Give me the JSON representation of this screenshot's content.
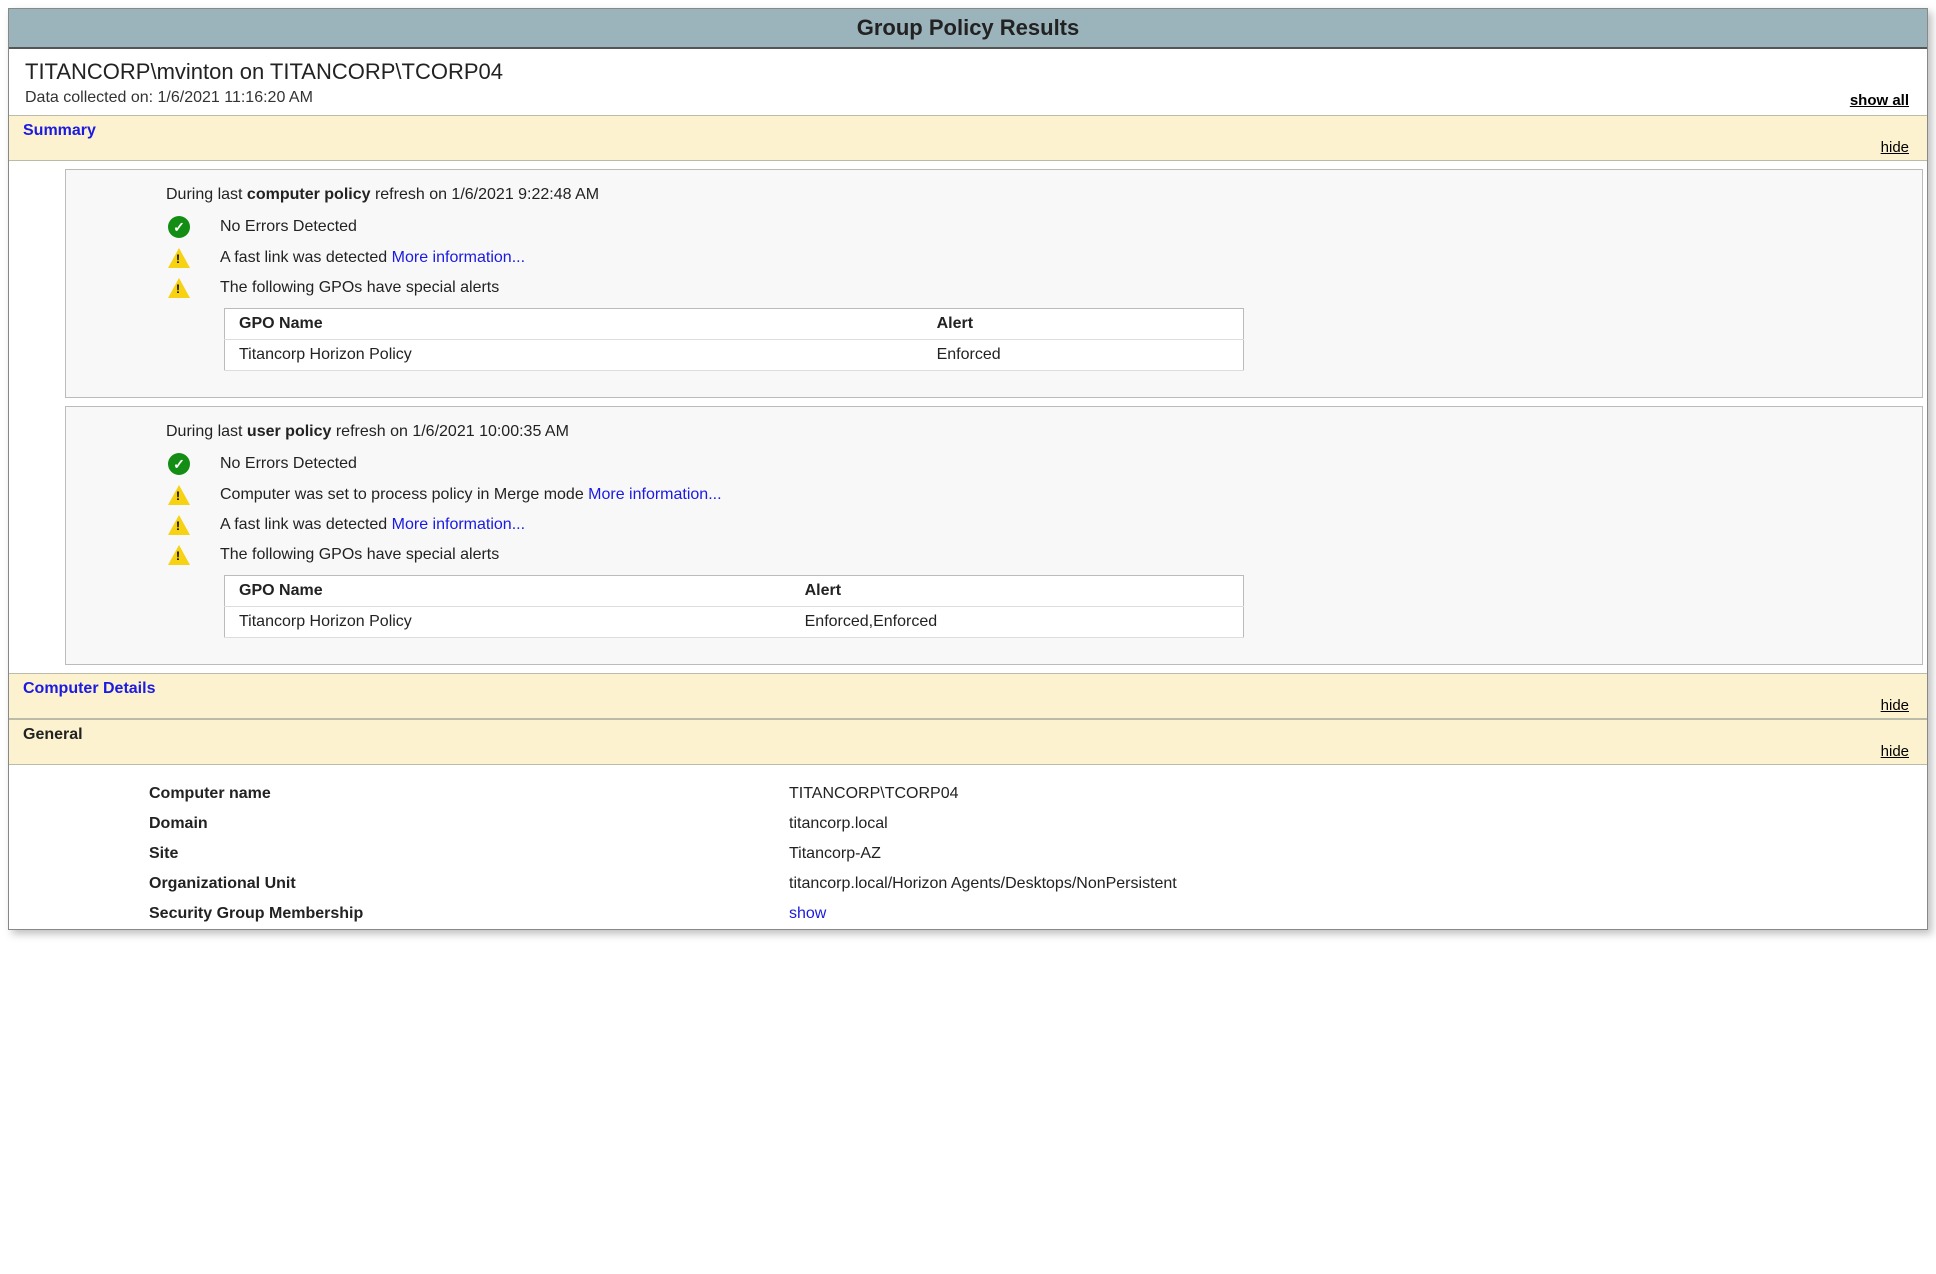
{
  "title": "Group Policy Results",
  "header": {
    "main": "TITANCORP\\mvinton on TITANCORP\\TCORP04",
    "collected_label": "Data collected on: 1/6/2021 11:16:20 AM",
    "show_all": "show all"
  },
  "sections": {
    "summary": {
      "label": "Summary",
      "toggle": "hide"
    },
    "computer_details": {
      "label": "Computer Details",
      "toggle": "hide"
    },
    "general": {
      "label": "General",
      "toggle": "hide"
    }
  },
  "summary": {
    "computer": {
      "heading_prefix": "During last ",
      "heading_bold": "computer policy",
      "heading_suffix": " refresh on 1/6/2021 9:22:48 AM",
      "rows": [
        {
          "icon": "check",
          "text": "No Errors Detected",
          "link": ""
        },
        {
          "icon": "warn",
          "text": "A fast link was detected ",
          "link": "More information..."
        },
        {
          "icon": "warn",
          "text": "The following GPOs have special alerts",
          "link": ""
        }
      ],
      "table": {
        "headers": [
          "GPO Name",
          "Alert"
        ],
        "rows": [
          [
            "Titancorp Horizon Policy",
            "Enforced"
          ]
        ]
      }
    },
    "user": {
      "heading_prefix": "During last ",
      "heading_bold": "user policy",
      "heading_suffix": " refresh on 1/6/2021 10:00:35 AM",
      "rows": [
        {
          "icon": "check",
          "text": "No Errors Detected",
          "link": ""
        },
        {
          "icon": "warn",
          "text": "Computer was set to process policy in Merge mode ",
          "link": "More information..."
        },
        {
          "icon": "warn",
          "text": "A fast link was detected ",
          "link": "More information..."
        },
        {
          "icon": "warn",
          "text": "The following GPOs have special alerts",
          "link": ""
        }
      ],
      "table": {
        "headers": [
          "GPO Name",
          "Alert"
        ],
        "rows": [
          [
            "Titancorp Horizon Policy",
            "Enforced,Enforced"
          ]
        ]
      }
    }
  },
  "general": {
    "rows": [
      {
        "key": "Computer name",
        "value": "TITANCORP\\TCORP04",
        "link": false
      },
      {
        "key": "Domain",
        "value": "titancorp.local",
        "link": false
      },
      {
        "key": "Site",
        "value": "Titancorp-AZ",
        "link": false
      },
      {
        "key": "Organizational Unit",
        "value": "titancorp.local/Horizon Agents/Desktops/NonPersistent",
        "link": false
      },
      {
        "key": "Security Group Membership",
        "value": "show",
        "link": true
      }
    ]
  }
}
